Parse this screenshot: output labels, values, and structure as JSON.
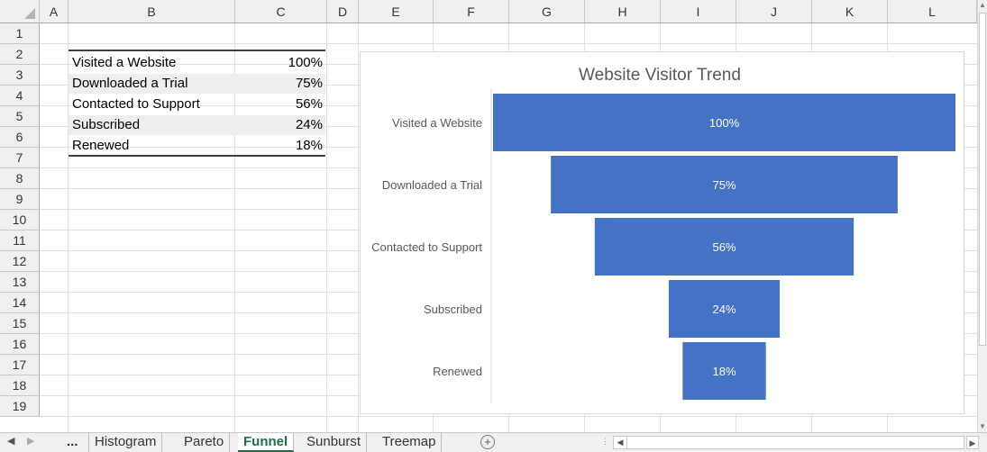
{
  "columns": [
    "A",
    "B",
    "C",
    "D",
    "E",
    "F",
    "G",
    "H",
    "I",
    "J",
    "K",
    "L"
  ],
  "rows": [
    "1",
    "2",
    "3",
    "4",
    "5",
    "6",
    "7",
    "8",
    "9",
    "10",
    "11",
    "12",
    "13",
    "14",
    "15",
    "16",
    "17",
    "18",
    "19"
  ],
  "table": [
    {
      "label": "Visited a Website",
      "value": "100%"
    },
    {
      "label": "Downloaded a Trial",
      "value": "75%"
    },
    {
      "label": "Contacted to Support",
      "value": "56%"
    },
    {
      "label": "Subscribed",
      "value": "24%"
    },
    {
      "label": "Renewed",
      "value": "18%"
    }
  ],
  "chart_data": {
    "type": "bar",
    "subtype": "funnel",
    "title": "Website Visitor Trend",
    "categories": [
      "Visited a Website",
      "Downloaded a Trial",
      "Contacted to Support",
      "Subscribed",
      "Renewed"
    ],
    "values": [
      100,
      75,
      56,
      24,
      18
    ],
    "labels": [
      "100%",
      "75%",
      "56%",
      "24%",
      "18%"
    ],
    "bar_color": "#4472c4",
    "label_color": "#ffffff",
    "grid": false,
    "legend": "none"
  },
  "tabs": {
    "overflow": "...",
    "items": [
      "Histogram",
      "Pareto",
      "Funnel",
      "Sunburst",
      "Treemap"
    ],
    "active": "Funnel",
    "add_icon": "plus-circle-icon"
  },
  "colors": {
    "accent": "#1e7145",
    "header_bg": "#f0f0f0",
    "band": "#eeeeee"
  }
}
